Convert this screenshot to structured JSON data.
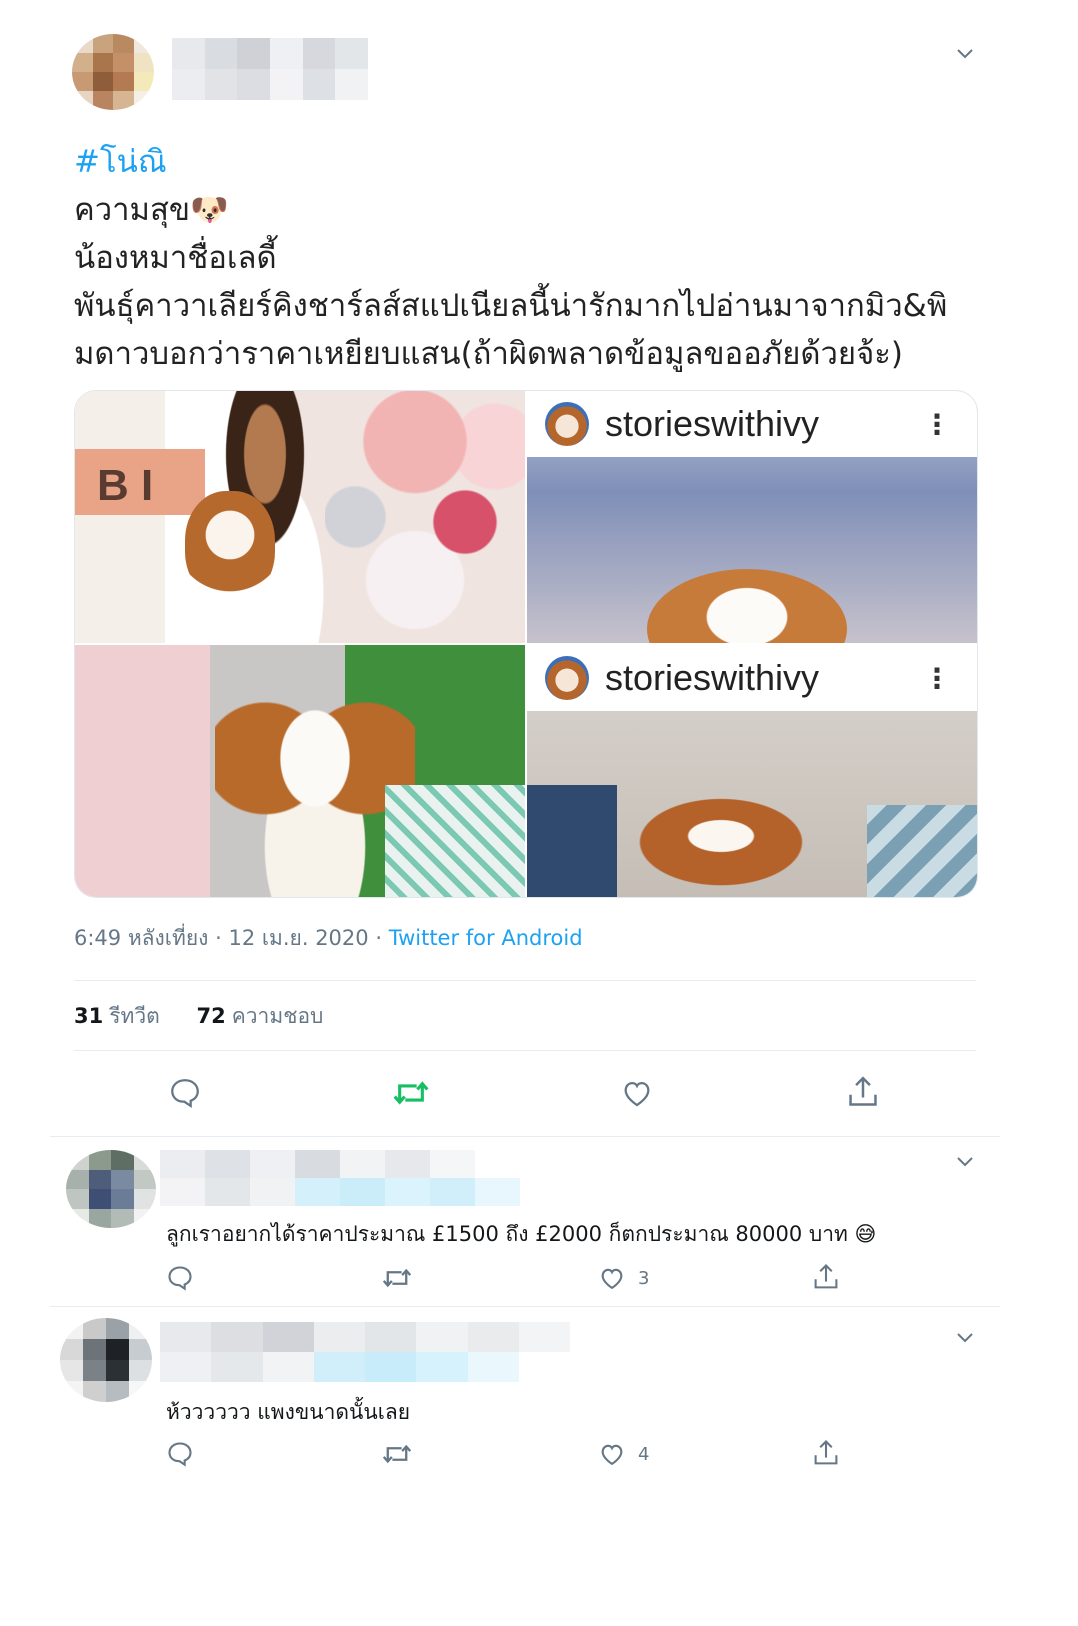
{
  "tweet": {
    "hashtag": "#โน่ณิ",
    "line1": "ความสุข",
    "line1_emoji": "🐶",
    "line2": "น้องหมาชื่อเลดี้",
    "line3": "พันธุ์คาวาเลียร์คิงชาร์ลส์สแปเนียลนี้น่ารักมากไปอ่านมาจากมิว&พิ",
    "line4": "มดาวบอกว่าราคาเหยียบแสน(ถ้าผิดพลาดข้อมูลขออภัยด้วยจ้ะ)",
    "media": {
      "ig_username": "storieswithivy",
      "ig_username_2": "storieswithivy",
      "ig_menu": "⋮",
      "balloon_letters": "B I"
    },
    "time": "6:49 หลังเที่ยง",
    "date": "12 เม.ย. 2020",
    "separator": "·",
    "source": "Twitter for Android",
    "retweets_count": "31",
    "retweets_label": "รีทวีต",
    "likes_count": "72",
    "likes_label": "ความชอบ"
  },
  "replies": [
    {
      "text": "ลูกเราอยากได้ราคาประมาณ £1500 ถึง £2000 ก็ตกประมาณ 80000 บาท",
      "emoji": "😅",
      "like_count": "3"
    },
    {
      "text": "ห้วววววว แพงขนาดนั้นเลย",
      "like_count": "4"
    }
  ],
  "colors": {
    "accent": "#1da1f2",
    "retweet_active": "#17bf63",
    "muted": "#657786"
  },
  "icons": [
    "chevron-down-icon",
    "reply-icon",
    "retweet-icon",
    "like-icon",
    "share-icon"
  ]
}
